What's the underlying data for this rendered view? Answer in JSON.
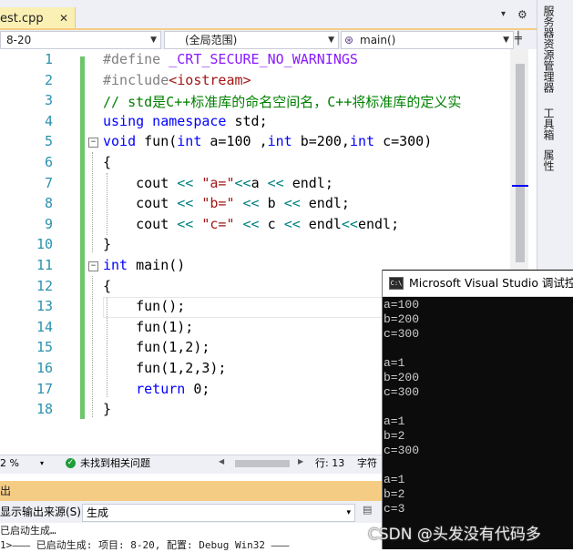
{
  "tab": {
    "filename": "est.cpp",
    "close_glyph": "✕"
  },
  "tabbar": {
    "dropdown_glyph": "▾",
    "settings_glyph": "⚙"
  },
  "navbar": {
    "project_combo": "8-20",
    "scope_combo": "(全局范围)",
    "function_combo": "main()",
    "function_icon": "cube-icon",
    "split_glyph": "╪"
  },
  "editor": {
    "line_numbers": [
      "1",
      "2",
      "3",
      "4",
      "5",
      "6",
      "7",
      "8",
      "9",
      "10",
      "11",
      "12",
      "13",
      "14",
      "15",
      "16",
      "17",
      "18"
    ],
    "lines": [
      [
        {
          "t": "#define ",
          "c": "#808080"
        },
        {
          "t": "_CRT_SECURE_NO_WARNINGS",
          "c": "#8a1bff"
        }
      ],
      [
        {
          "t": "#include",
          "c": "#808080"
        },
        {
          "t": "<iostream>",
          "c": "#a31515"
        }
      ],
      [
        {
          "t": "// std是C++标准库的命名空间名，C++将标准库的定义实",
          "c": "#008000"
        }
      ],
      [
        {
          "t": "using namespace ",
          "c": "#0000ff"
        },
        {
          "t": "std;",
          "c": "#000000"
        }
      ],
      [
        {
          "t": "void ",
          "c": "#0000ff"
        },
        {
          "t": "fun(",
          "c": "#000000"
        },
        {
          "t": "int ",
          "c": "#0000ff"
        },
        {
          "t": "a=100 ,",
          "c": "#000000"
        },
        {
          "t": "int ",
          "c": "#0000ff"
        },
        {
          "t": "b=200,",
          "c": "#000000"
        },
        {
          "t": "int ",
          "c": "#0000ff"
        },
        {
          "t": "c=300)",
          "c": "#000000"
        }
      ],
      [
        {
          "t": "{",
          "c": "#000000"
        }
      ],
      [
        {
          "t": "    cout ",
          "c": "#000000"
        },
        {
          "t": "<< ",
          "c": "#008080"
        },
        {
          "t": "\"a=\"",
          "c": "#a31515"
        },
        {
          "t": "<<",
          "c": "#008080"
        },
        {
          "t": "a ",
          "c": "#000000"
        },
        {
          "t": "<< ",
          "c": "#008080"
        },
        {
          "t": "endl;",
          "c": "#000000"
        }
      ],
      [
        {
          "t": "    cout ",
          "c": "#000000"
        },
        {
          "t": "<< ",
          "c": "#008080"
        },
        {
          "t": "\"b=\" ",
          "c": "#a31515"
        },
        {
          "t": "<< ",
          "c": "#008080"
        },
        {
          "t": "b ",
          "c": "#000000"
        },
        {
          "t": "<< ",
          "c": "#008080"
        },
        {
          "t": "endl;",
          "c": "#000000"
        }
      ],
      [
        {
          "t": "    cout ",
          "c": "#000000"
        },
        {
          "t": "<< ",
          "c": "#008080"
        },
        {
          "t": "\"c=\" ",
          "c": "#a31515"
        },
        {
          "t": "<< ",
          "c": "#008080"
        },
        {
          "t": "c ",
          "c": "#000000"
        },
        {
          "t": "<< ",
          "c": "#008080"
        },
        {
          "t": "endl",
          "c": "#000000"
        },
        {
          "t": "<<",
          "c": "#008080"
        },
        {
          "t": "endl;",
          "c": "#000000"
        }
      ],
      [
        {
          "t": "}",
          "c": "#000000"
        }
      ],
      [
        {
          "t": "int ",
          "c": "#0000ff"
        },
        {
          "t": "main()",
          "c": "#000000"
        }
      ],
      [
        {
          "t": "{",
          "c": "#000000"
        }
      ],
      [
        {
          "t": "    fun();",
          "c": "#000000"
        }
      ],
      [
        {
          "t": "    fun(1);",
          "c": "#000000"
        }
      ],
      [
        {
          "t": "    fun(1,2);",
          "c": "#000000"
        }
      ],
      [
        {
          "t": "    fun(1,2,3);",
          "c": "#000000"
        }
      ],
      [
        {
          "t": "    return ",
          "c": "#0000ff"
        },
        {
          "t": "0;",
          "c": "#000000"
        }
      ],
      [
        {
          "t": "}",
          "c": "#000000"
        }
      ]
    ],
    "fold_glyph": "−"
  },
  "side_tabs": [
    "服务器资源管理器",
    "工具箱",
    "属性"
  ],
  "status": {
    "zoom": "2 %",
    "zoom_arrow": "▾",
    "issue_check": "✓",
    "issue_text": "未找到相关问题",
    "scroll_left": "◀",
    "scroll_right": "▶",
    "row": "行: 13",
    "col": "字符"
  },
  "output": {
    "title": "出",
    "source_label": "显示输出来源(S):",
    "source_value": "生成",
    "source_arrow": "▾",
    "line1": "已启动生成…",
    "line2": "1>——— 已启动生成: 项目: 8-20, 配置: Debug Win32 ———"
  },
  "console": {
    "title": "Microsoft Visual Studio 调试控制台",
    "icon_text": "C:\\",
    "lines": [
      "a=100",
      "b=200",
      "c=300",
      "",
      "a=1",
      "b=200",
      "c=300",
      "",
      "a=1",
      "b=2",
      "c=300",
      "",
      "a=1",
      "b=2",
      "c=3"
    ]
  },
  "watermark": "CSDN @头发没有代码多"
}
